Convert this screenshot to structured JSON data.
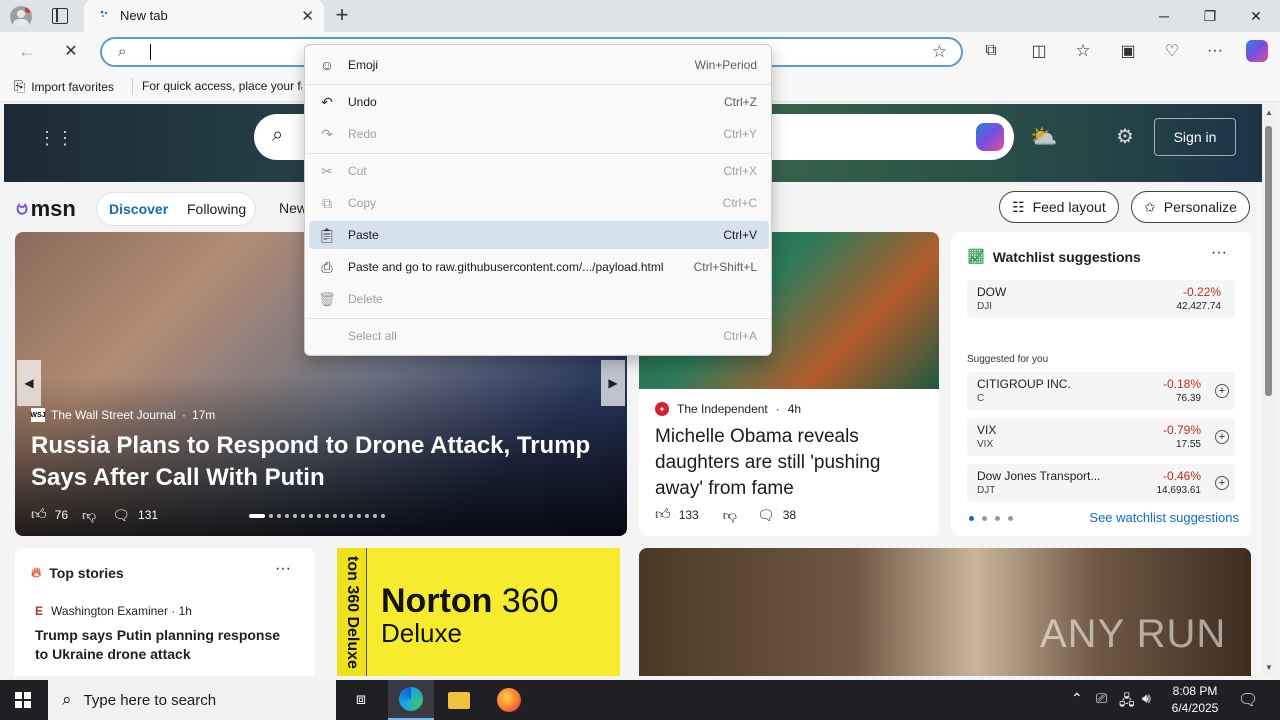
{
  "browser": {
    "tab_title": "New tab",
    "new_tab_symbol": "+"
  },
  "favorites": {
    "import_label": "Import favorites",
    "hint": "For quick access, place your fav"
  },
  "msn": {
    "logo_text": "msn",
    "nav": {
      "discover": "Discover",
      "following": "Following",
      "news": "New"
    },
    "feed_layout": "Feed layout",
    "personalize": "Personalize",
    "sign_in": "Sign in"
  },
  "main_story": {
    "source": "The Wall Street Journal",
    "time": "17m",
    "source_logo": "WSJ",
    "headline": "Russia Plans to Respond to Drone Attack, Trump Says After Call With Putin",
    "likes": "76",
    "comments": "131"
  },
  "side_story": {
    "source": "The Independent",
    "time": "4h",
    "headline": "Michelle Obama reveals daughters are still 'pushing away' from fame",
    "likes": "133",
    "comments": "38"
  },
  "watchlist": {
    "title": "Watchlist suggestions",
    "suggested_label": "Suggested for you",
    "see_all": "See watchlist suggestions",
    "rows": [
      {
        "name": "DOW",
        "ticker": "DJI",
        "change": "-0.22%",
        "value": "42,427.74"
      },
      {
        "name": "CITIGROUP INC.",
        "ticker": "C",
        "change": "-0.18%",
        "value": "76.39"
      },
      {
        "name": "VIX",
        "ticker": "VIX",
        "change": "-0.79%",
        "value": "17.55"
      },
      {
        "name": "Dow Jones Transport...",
        "ticker": "DJT",
        "change": "-0.46%",
        "value": "14,693.61"
      }
    ]
  },
  "top_stories": {
    "title": "Top stories",
    "source": "Washington Examiner · 1h",
    "headline": "Trump says Putin planning response to Ukraine drone attack"
  },
  "ad": {
    "brand": "Norton",
    "version": "360",
    "product": "Deluxe",
    "side_text": "ton 360 Deluxe"
  },
  "watermark": "ANY RUN",
  "context_menu": {
    "items": [
      {
        "label": "Emoji",
        "shortcut": "Win+Period",
        "icon": "emoji-icon"
      },
      {
        "label": "Undo",
        "shortcut": "Ctrl+Z",
        "icon": "undo-icon"
      },
      {
        "label": "Redo",
        "shortcut": "Ctrl+Y",
        "icon": "redo-icon"
      },
      {
        "label": "Cut",
        "shortcut": "Ctrl+X",
        "icon": "cut-icon"
      },
      {
        "label": "Copy",
        "shortcut": "Ctrl+C",
        "icon": "copy-icon"
      },
      {
        "label": "Paste",
        "shortcut": "Ctrl+V",
        "icon": "paste-icon"
      },
      {
        "label": "Paste and go to raw.githubusercontent.com/.../payload.html",
        "shortcut": "Ctrl+Shift+L",
        "icon": "paste-go-icon"
      },
      {
        "label": "Delete",
        "shortcut": "",
        "icon": "delete-icon"
      },
      {
        "label": "Select all",
        "shortcut": "Ctrl+A",
        "icon": ""
      }
    ]
  },
  "taskbar": {
    "search_placeholder": "Type here to search",
    "time": "8:08 PM",
    "date": "6/4/2025"
  },
  "colors": {
    "accent": "#0f6cbd",
    "negative": "#c42b1c",
    "highlight": "#d5e1ee"
  }
}
